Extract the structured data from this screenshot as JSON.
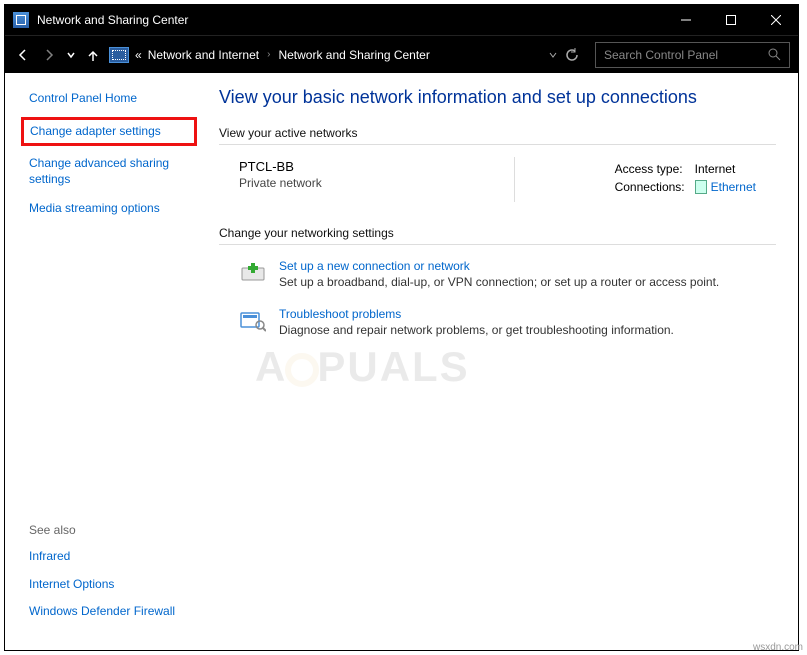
{
  "window": {
    "title": "Network and Sharing Center"
  },
  "nav": {
    "crumb_prefix": "«",
    "crumb1": "Network and Internet",
    "crumb2": "Network and Sharing Center",
    "search_placeholder": "Search Control Panel"
  },
  "sidebar": {
    "home": "Control Panel Home",
    "adapter": "Change adapter settings",
    "advanced": "Change advanced sharing settings",
    "media": "Media streaming options",
    "see_also_hdr": "See also",
    "infrared": "Infrared",
    "inet_opts": "Internet Options",
    "firewall": "Windows Defender Firewall"
  },
  "main": {
    "heading": "View your basic network information and set up connections",
    "active_hdr": "View your active networks",
    "net_name": "PTCL-BB",
    "net_type": "Private network",
    "access_label": "Access type:",
    "access_value": "Internet",
    "conn_label": "Connections:",
    "conn_value": "Ethernet",
    "change_hdr": "Change your networking settings",
    "setup_title": "Set up a new connection or network",
    "setup_desc": "Set up a broadband, dial-up, or VPN connection; or set up a router or access point.",
    "trouble_title": "Troubleshoot problems",
    "trouble_desc": "Diagnose and repair network problems, or get troubleshooting information."
  },
  "watermark": "A  PUALS",
  "footer": "wsxdn.com"
}
